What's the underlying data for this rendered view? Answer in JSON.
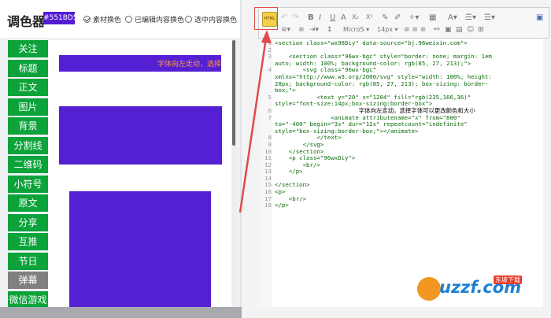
{
  "app": {
    "title": "调色器",
    "color_value": "#551BD5",
    "options": [
      "素材换色",
      "已编辑内容换色",
      "选中内容换色"
    ]
  },
  "nav": {
    "items": [
      "关注",
      "标题",
      "正文",
      "图片",
      "背景",
      "分割线",
      "二维码",
      "小符号",
      "原文",
      "分享",
      "互推",
      "节日",
      "弹幕",
      "微信游戏"
    ],
    "active": "弹幕"
  },
  "preview": {
    "scrolling_text": "字体向左走动，选择"
  },
  "toolbar": {
    "html_button": "HTML",
    "font": "MicroS",
    "size": "14px",
    "format_icons": [
      "B",
      "I",
      "U",
      "A",
      "X₂",
      "X²"
    ]
  },
  "editor": {
    "lines": [
      {
        "n": "1",
        "text": "<section class=\"wx96Diy\" data-source=\"bj.96weixin.com\">"
      },
      {
        "n": "2",
        "text": ""
      },
      {
        "n": "3",
        "text": "    <section class=\"96wx-bgc\" style=\"border: none; margin: 1em"
      },
      {
        "n": "",
        "text": "auto; width: 100%; background-color: rgb(85, 27, 213);\">"
      },
      {
        "n": "4",
        "text": "        <svg class=\"96wx-bgc\""
      },
      {
        "n": "",
        "text": "xmlns=\"http://www.w3.org/2000/svg\" style=\"width: 100%; height:"
      },
      {
        "n": "",
        "text": "28px; background-color: rgb(85, 27, 213); box-sizing: border-"
      },
      {
        "n": "",
        "text": "box;\">"
      },
      {
        "n": "5",
        "text": "            <text y=\"20\" x=\"1204\" fill=\"rgb(235,166,36)\""
      },
      {
        "n": "",
        "text": "style=\"font-size:14px;box-sizing:border-box\">"
      },
      {
        "n": "6",
        "text": "                        字体向左走动，选择字体可以更改颜色和大小"
      },
      {
        "n": "7",
        "text": "                <animate attributename=\"x\" from=\"800\""
      },
      {
        "n": "",
        "text": "to=\"-400\" begin=\"3s\" dur=\"11s\" repeatcount=\"indefinite\""
      },
      {
        "n": "",
        "text": "style=\"box-sizing:border-box;\"></animate>"
      },
      {
        "n": "8",
        "text": "            </text>"
      },
      {
        "n": "9",
        "text": "        </svg>"
      },
      {
        "n": "10",
        "text": "    </section>"
      },
      {
        "n": "11",
        "text": "    <p class=\"96wxDiy\">"
      },
      {
        "n": "12",
        "text": "        <br/>"
      },
      {
        "n": "13",
        "text": "    </p>"
      },
      {
        "n": "14",
        "text": ""
      },
      {
        "n": "15",
        "text": "</section>"
      },
      {
        "n": "16",
        "text": "<p>"
      },
      {
        "n": "17",
        "text": "    <br/>"
      },
      {
        "n": "18",
        "text": "</p>"
      }
    ]
  },
  "watermark": {
    "brand": "uzzf.com",
    "tag": "东坡下载"
  }
}
